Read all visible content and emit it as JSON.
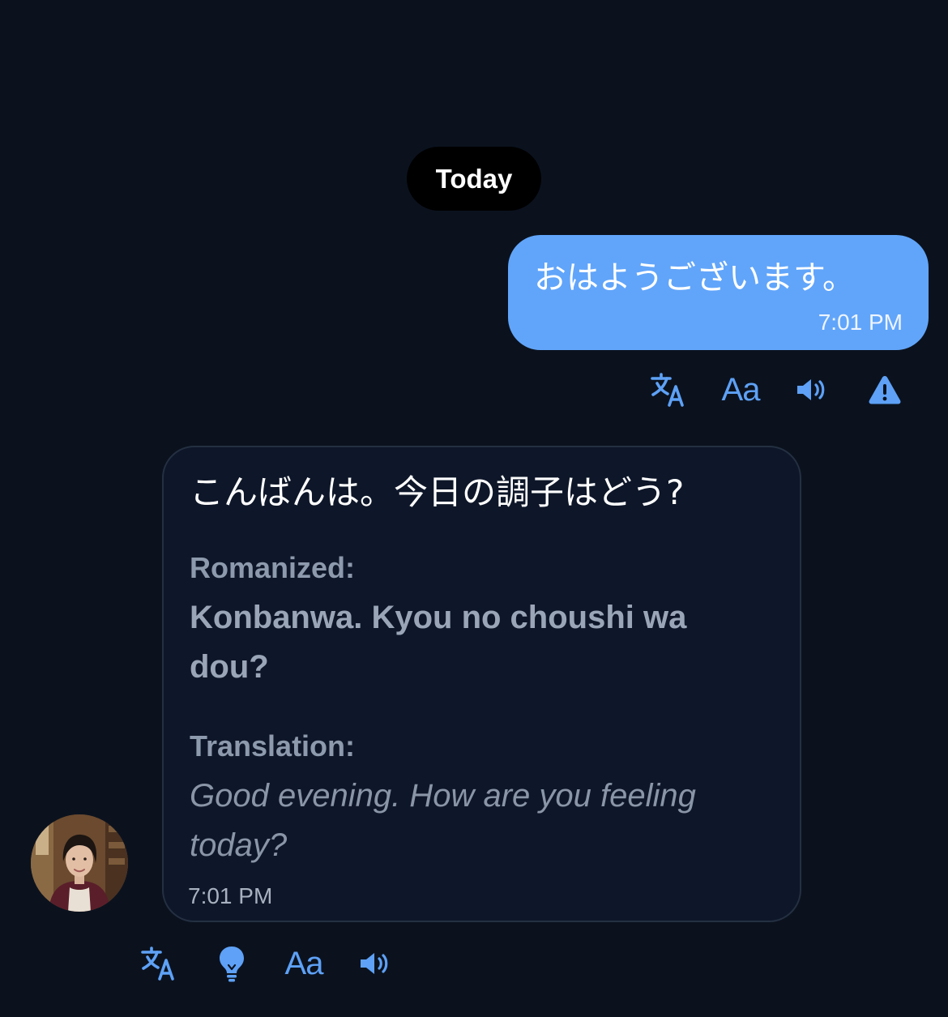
{
  "date_divider": {
    "label": "Today"
  },
  "sent_message": {
    "text": "おはようございます。",
    "time": "7:01 PM",
    "bubble_color": "#61a5fa"
  },
  "sent_actions": [
    {
      "icon": "translate-icon"
    },
    {
      "icon": "text-size-icon",
      "label": "Aa"
    },
    {
      "icon": "speaker-icon"
    },
    {
      "icon": "warning-icon"
    }
  ],
  "received_message": {
    "text": "こんばんは。今日の調子はどう?",
    "romanized_label": "Romanized:",
    "romanized": "Konbanwa. Kyou no choushi wa dou?",
    "translation_label": "Translation:",
    "translation": "Good evening. How are you feeling today?",
    "time": "7:01 PM"
  },
  "received_actions": [
    {
      "icon": "translate-icon"
    },
    {
      "icon": "lightbulb-icon"
    },
    {
      "icon": "text-size-icon",
      "label": "Aa"
    },
    {
      "icon": "speaker-icon"
    }
  ],
  "accent_color": "#5ea1f6"
}
